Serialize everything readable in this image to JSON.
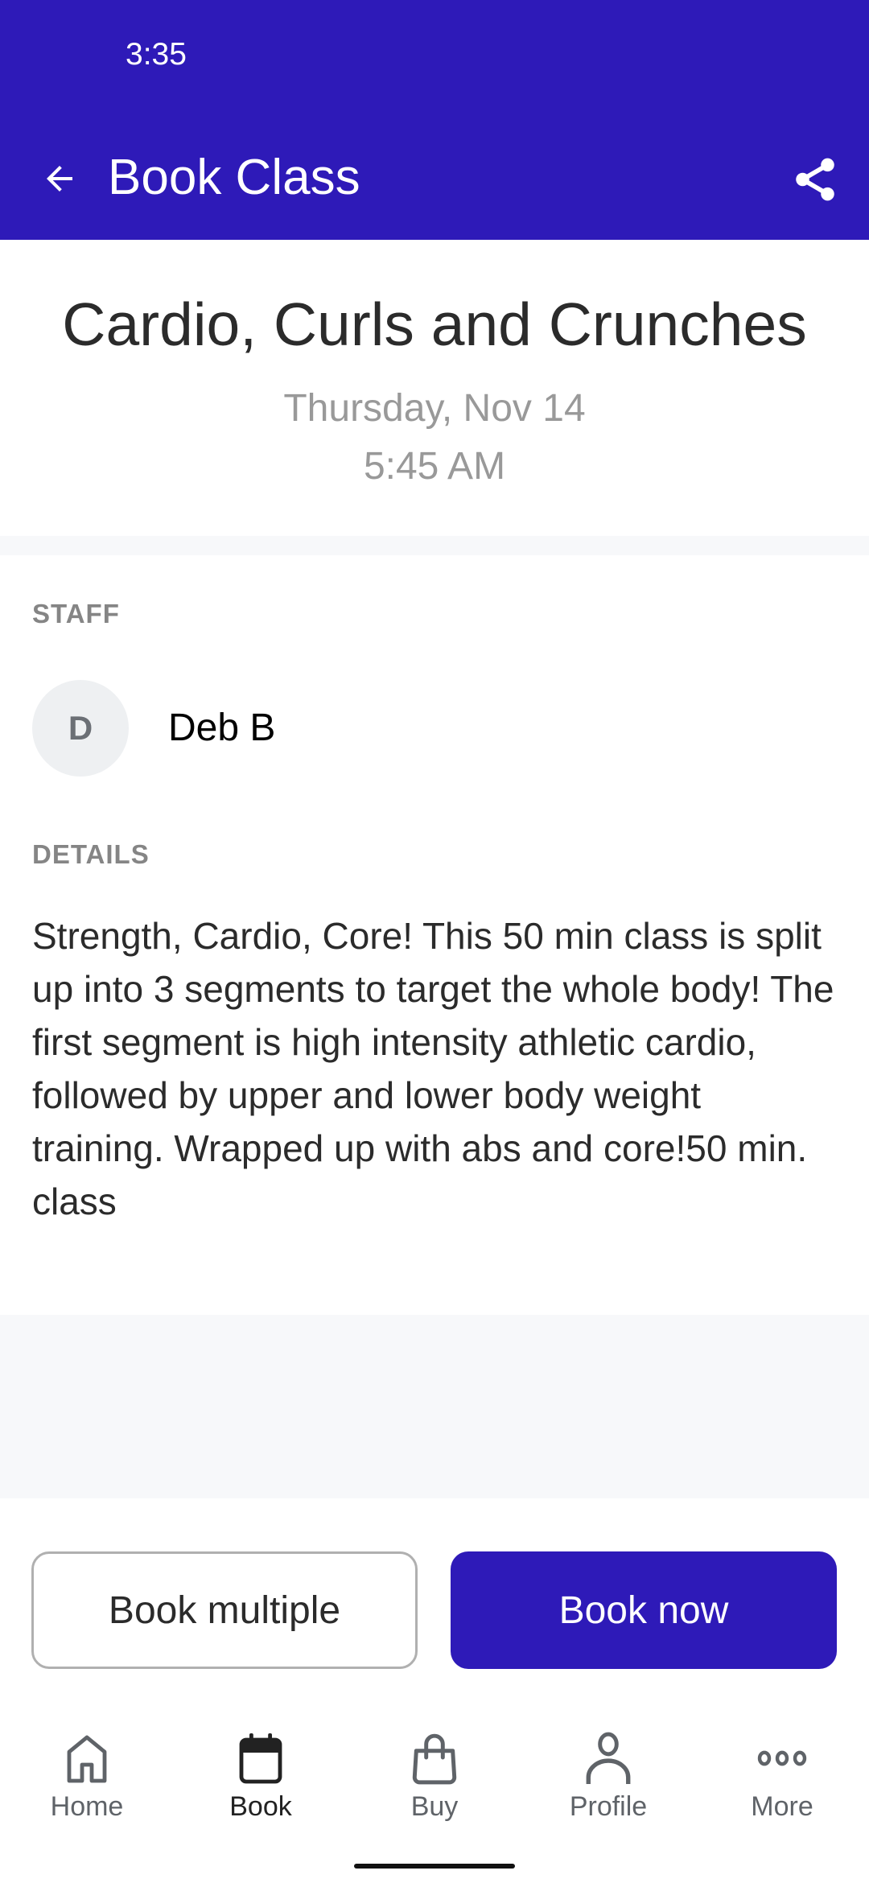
{
  "status_bar": {
    "time": "3:35"
  },
  "app_bar": {
    "title": "Book Class",
    "back_icon": "arrow-left-icon",
    "share_icon": "share-icon",
    "color": "#2e1ab8"
  },
  "class": {
    "title": "Cardio, Curls and Crunches",
    "date": "Thursday, Nov 14",
    "time": "5:45 AM"
  },
  "staff": {
    "label": "STAFF",
    "members": [
      {
        "initial": "D",
        "name": "Deb B"
      }
    ]
  },
  "details": {
    "label": "DETAILS",
    "text": "Strength, Cardio, Core! This 50 min class is split up into 3 segments to target the whole body! The first segment is high intensity athletic cardio, followed by upper and lower body weight training. Wrapped up with abs and core!50 min. class"
  },
  "actions": {
    "book_multiple": "Book multiple",
    "book_now": "Book now"
  },
  "bottom_nav": {
    "items": [
      {
        "label": "Home",
        "icon": "home-icon",
        "active": false
      },
      {
        "label": "Book",
        "icon": "calendar-icon",
        "active": true
      },
      {
        "label": "Buy",
        "icon": "shopping-bag-icon",
        "active": false
      },
      {
        "label": "Profile",
        "icon": "person-icon",
        "active": false
      },
      {
        "label": "More",
        "icon": "more-horizontal-icon",
        "active": false
      }
    ]
  }
}
